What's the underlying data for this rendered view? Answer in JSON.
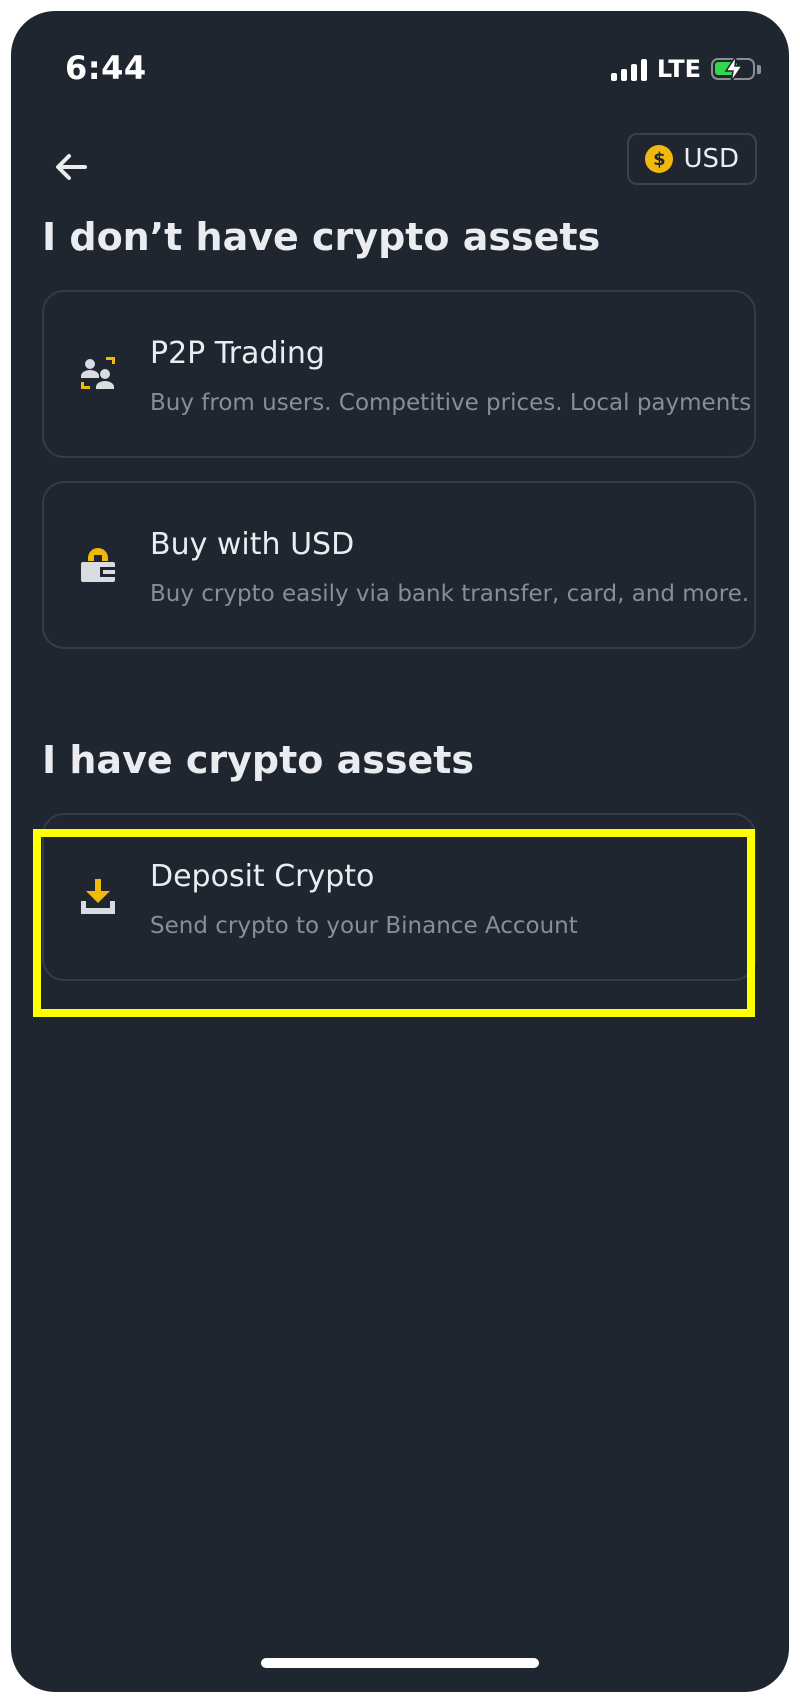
{
  "status_bar": {
    "time": "6:44",
    "network": "LTE"
  },
  "header": {
    "currency_symbol": "$",
    "currency_label": "USD"
  },
  "sections": [
    {
      "title": "I don’t have crypto assets",
      "options": [
        {
          "icon": "p2p-users-icon",
          "title": "P2P Trading",
          "description": "Buy from users. Competitive prices. Local payments"
        },
        {
          "icon": "wallet-lock-icon",
          "title": "Buy with USD",
          "description": "Buy crypto easily via bank transfer, card, and more."
        }
      ]
    },
    {
      "title": "I have crypto assets",
      "options": [
        {
          "icon": "download-icon",
          "title": "Deposit Crypto",
          "description": "Send crypto to your Binance Account"
        }
      ]
    }
  ],
  "colors": {
    "background": "#1F2630",
    "accent": "#F0B90B",
    "highlight": "#FFFF00",
    "card_border": "#343C48",
    "secondary_text": "#848E9C"
  }
}
